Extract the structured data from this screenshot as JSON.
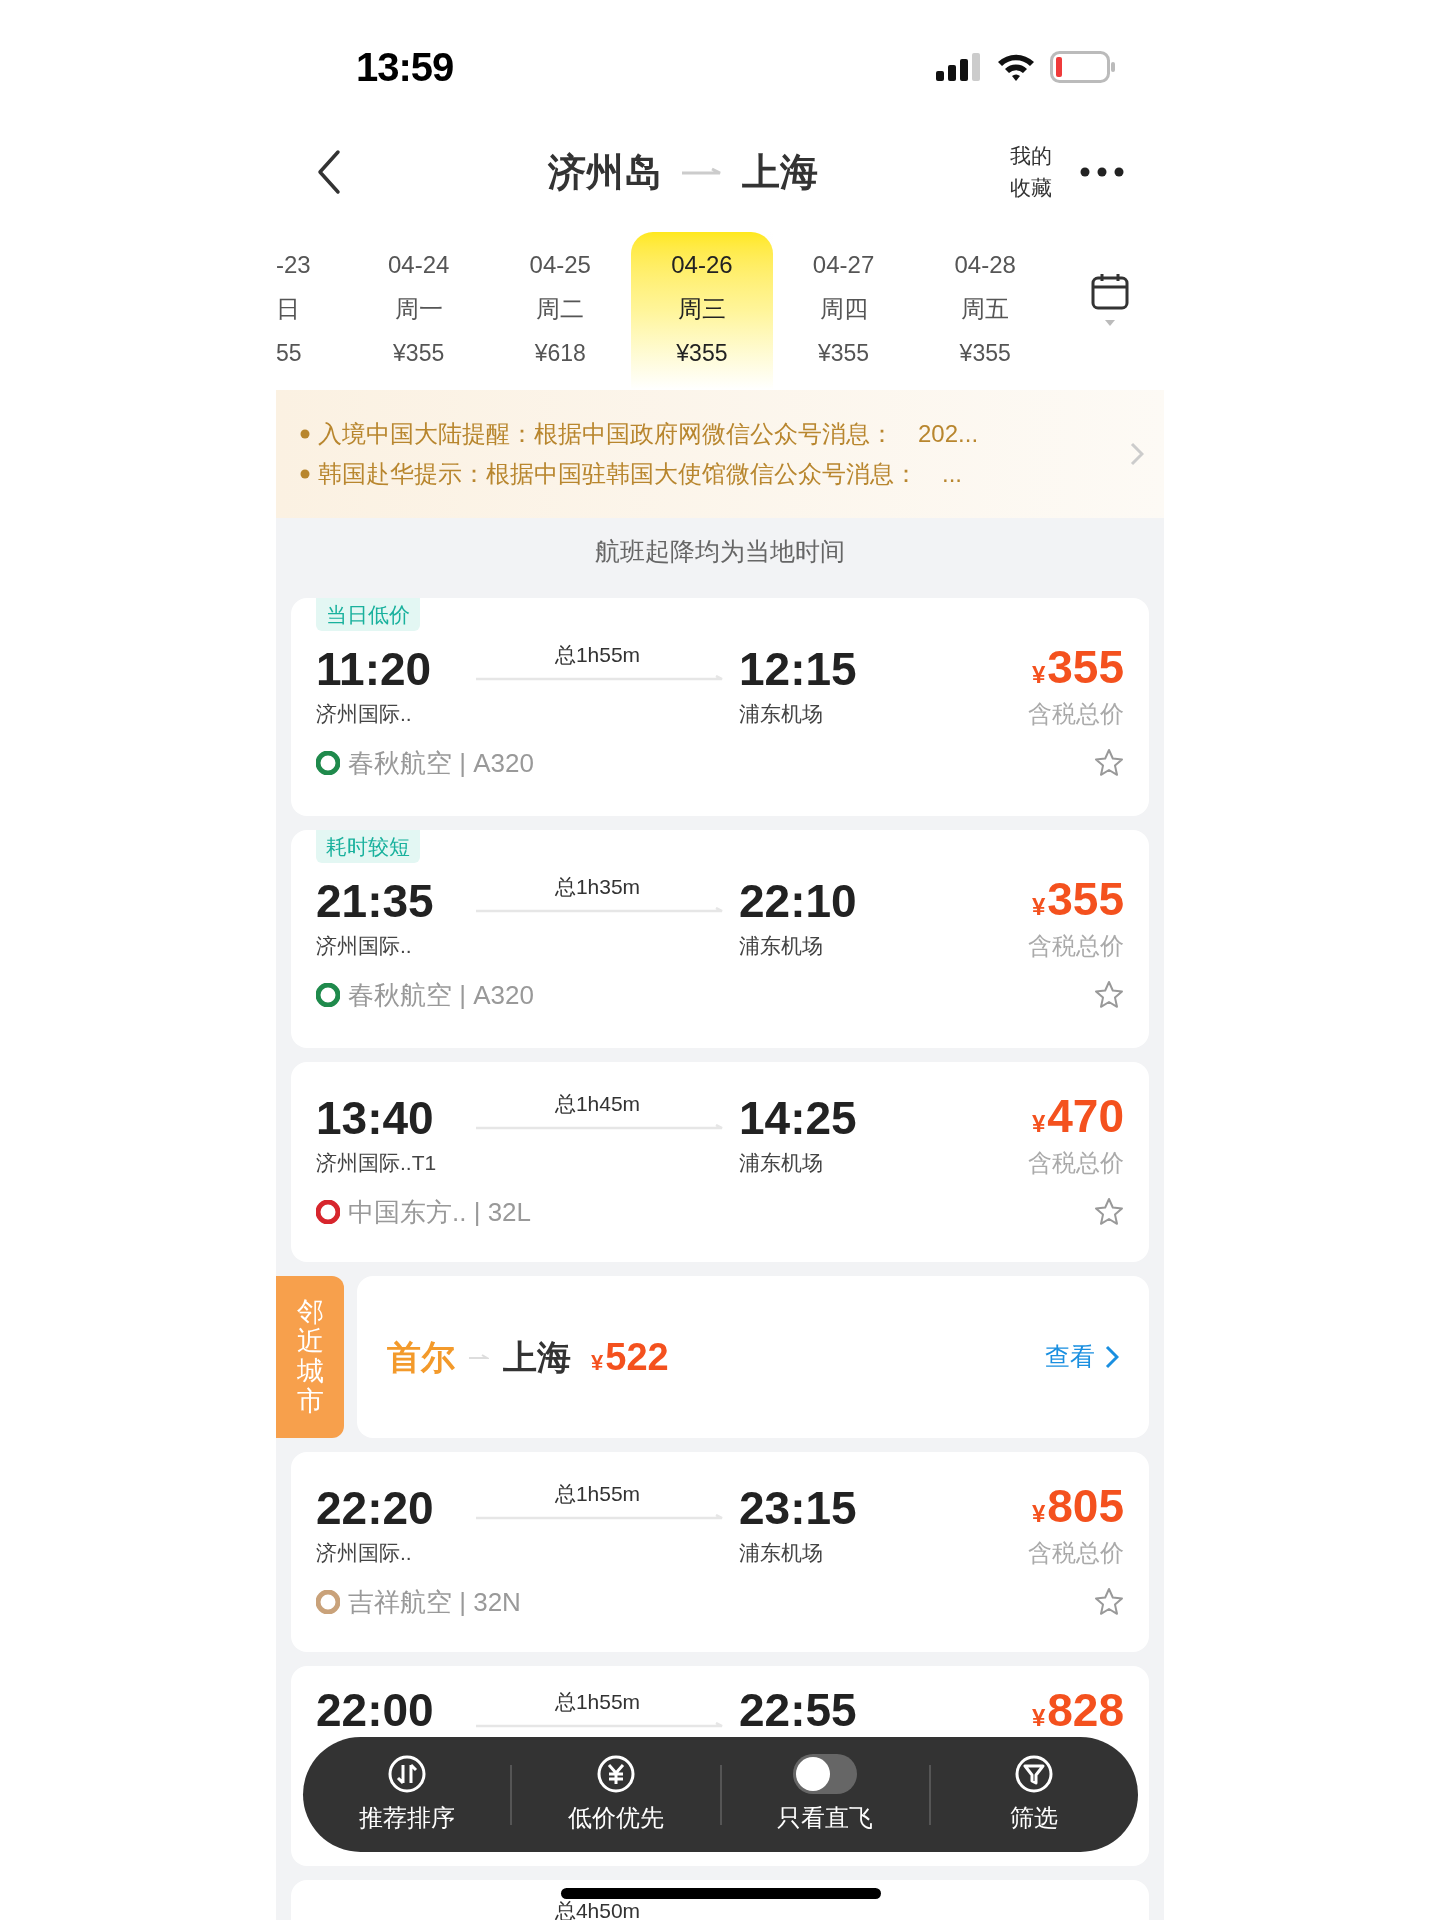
{
  "status_bar": {
    "time": "13:59"
  },
  "header": {
    "origin": "济州岛",
    "destination": "上海",
    "favorites": "我的收藏"
  },
  "dates": [
    {
      "date": "-23",
      "weekday": "日",
      "price": "55",
      "selected": false
    },
    {
      "date": "04-24",
      "weekday": "周一",
      "price": "¥355",
      "selected": false
    },
    {
      "date": "04-25",
      "weekday": "周二",
      "price": "¥618",
      "selected": false
    },
    {
      "date": "04-26",
      "weekday": "周三",
      "price": "¥355",
      "selected": true
    },
    {
      "date": "04-27",
      "weekday": "周四",
      "price": "¥355",
      "selected": false
    },
    {
      "date": "04-28",
      "weekday": "周五",
      "price": "¥355",
      "selected": false
    }
  ],
  "notices": [
    "入境中国大陆提醒：根据中国政府网微信公众号消息：　202...",
    "韩国赴华提示：根据中国驻韩国大使馆微信公众号消息：　..."
  ],
  "time_note": "航班起降均为当地时间",
  "flights": [
    {
      "kind": "flight",
      "tag": "当日低价",
      "dep_time": "11:20",
      "duration": "总1h55m",
      "arr_time": "12:15",
      "dep_airport": "济州国际..",
      "arr_airport": "浦东机场",
      "currency": "¥",
      "price": "355",
      "price_label": "含税总价",
      "airline": "春秋航空 | A320",
      "color": "#1f8a4c"
    },
    {
      "kind": "flight",
      "tag": "耗时较短",
      "dep_time": "21:35",
      "duration": "总1h35m",
      "arr_time": "22:10",
      "dep_airport": "济州国际..",
      "arr_airport": "浦东机场",
      "currency": "¥",
      "price": "355",
      "price_label": "含税总价",
      "airline": "春秋航空 | A320",
      "color": "#1f8a4c"
    },
    {
      "kind": "flight",
      "dep_time": "13:40",
      "duration": "总1h45m",
      "arr_time": "14:25",
      "dep_airport": "济州国际..T1",
      "arr_airport": "浦东机场",
      "currency": "¥",
      "price": "470",
      "price_label": "含税总价",
      "airline": "中国东方.. | 32L",
      "color": "#d7262d"
    },
    {
      "kind": "nearby",
      "side_label": "邻近城市",
      "origin": "首尔",
      "destination": "上海",
      "currency": "¥",
      "price": "522",
      "link": "查看"
    },
    {
      "kind": "flight",
      "dep_time": "22:20",
      "duration": "总1h55m",
      "arr_time": "23:15",
      "dep_airport": "济州国际..",
      "arr_airport": "浦东机场",
      "currency": "¥",
      "price": "805",
      "price_label": "含税总价",
      "airline": "吉祥航空 | 32N",
      "color": "#c9a27a"
    },
    {
      "kind": "flight",
      "dep_time": "22:00",
      "duration": "总1h55m",
      "arr_time": "22:55",
      "currency": "¥",
      "price": "828"
    },
    {
      "kind": "flight",
      "duration": "总4h50m"
    }
  ],
  "toolbar": [
    {
      "kind": "button",
      "label": "推荐排序"
    },
    {
      "kind": "button",
      "label": "低价优先"
    },
    {
      "kind": "toggle",
      "label": "只看直飞",
      "on": false
    },
    {
      "kind": "button",
      "label": "筛选"
    }
  ]
}
